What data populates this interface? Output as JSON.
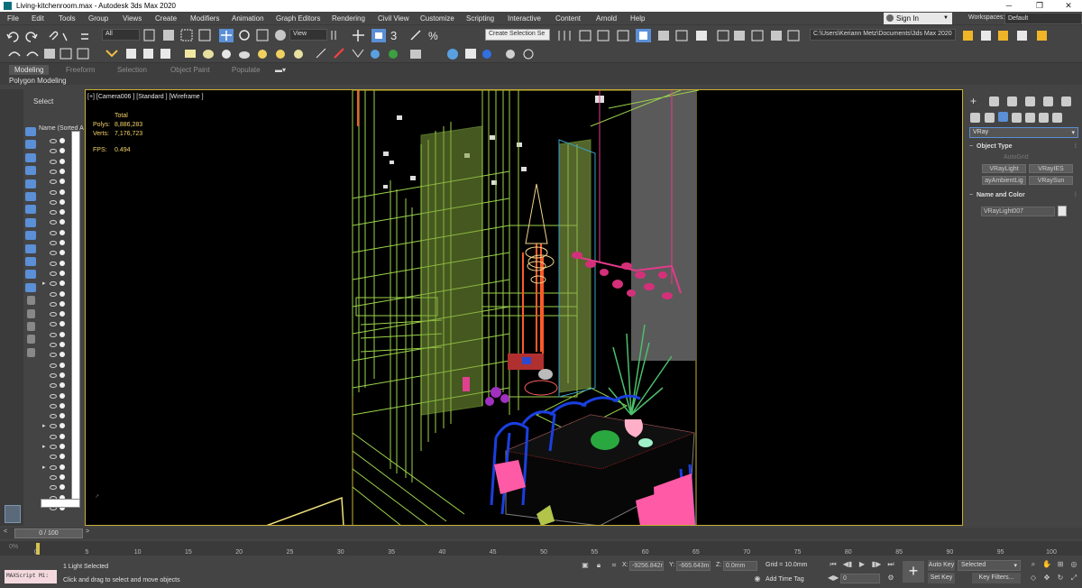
{
  "window": {
    "title": "Living-kitchenroom.max - Autodesk 3ds Max 2020",
    "min_glyph": "─",
    "max_glyph": "❐",
    "close_glyph": "✕"
  },
  "menu": [
    "File",
    "Edit",
    "Tools",
    "Group",
    "Views",
    "Create",
    "Modifiers",
    "Animation",
    "Graph Editors",
    "Rendering",
    "Civil View",
    "Customize",
    "Scripting",
    "Interactive",
    "Content",
    "Arnold",
    "Help"
  ],
  "signin": {
    "label": "Sign In"
  },
  "workspaces": {
    "label": "Workspaces:",
    "value": "Default"
  },
  "toolbar": {
    "selection_filter": "All",
    "ref_coord": "View",
    "selection_set": "Create Selection Se",
    "project_path": "C:\\Users\\Keriann Metz\\Documents\\3ds Max 2020"
  },
  "ribbon": {
    "tabs": [
      "Modeling",
      "Freeform",
      "Selection",
      "Object Paint",
      "Populate"
    ],
    "sub": "Polygon Modeling"
  },
  "explorer": {
    "header": "Select",
    "column": "Name (Sorted A"
  },
  "viewport": {
    "label": "[+] [Camera006 ] [Standard ] [Wireframe ]",
    "stats": {
      "total_label": "Total",
      "polys_label": "Polys:",
      "polys": "8,886,283",
      "verts_label": "Verts:",
      "verts": "7,176,723",
      "fps_label": "FPS:",
      "fps": "0.494"
    }
  },
  "command_panel": {
    "category": "VRay",
    "object_type": {
      "title": "Object Type",
      "autogrid": "AutoGrid",
      "buttons": [
        "VRayLight",
        "VRayIES",
        "ayAmbientLig",
        "VRaySun"
      ]
    },
    "name_color": {
      "title": "Name and Color",
      "name": "VRayLight007",
      "color": "#e8e8e8"
    }
  },
  "timeline": {
    "frame": "0 / 100",
    "prev": "<",
    "next": ">",
    "ticks": [
      "0",
      "5",
      "10",
      "15",
      "20",
      "25",
      "30",
      "35",
      "40",
      "45",
      "50",
      "55",
      "60",
      "65",
      "70",
      "75",
      "80",
      "85",
      "90",
      "95",
      "100"
    ]
  },
  "status": {
    "maxscript": "MAXScript Mi:",
    "selection": "1 Light Selected",
    "prompt": "Click and drag to select and move objects",
    "x_label": "X:",
    "x": "-9256.842r",
    "y_label": "Y:",
    "y": "-665.643m",
    "z_label": "Z:",
    "z": "0.0mm",
    "grid": "Grid = 10.0mm",
    "add_time_tag": "Add Time Tag",
    "frame_value": "0",
    "auto_key": "Auto Key",
    "set_key": "Set Key",
    "key_mode": "Selected",
    "key_filters": "Key Filters..."
  },
  "colors": {
    "ui_bg": "#444444",
    "viewport_border": "#c8b034",
    "active_blue": "#5b8fd6",
    "stats_yellow": "#f5d36b",
    "wire_green": "#9bd34a",
    "wire_blue": "#1a3fe0",
    "wire_pink": "#e23a8a",
    "wire_orange": "#ff5a2a"
  }
}
